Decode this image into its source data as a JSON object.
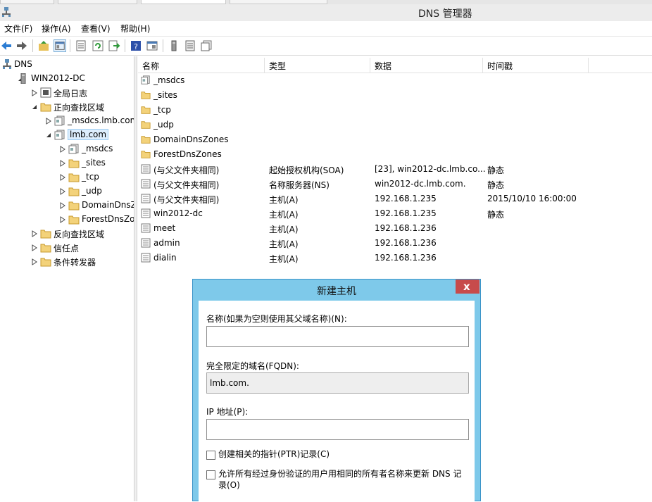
{
  "window": {
    "title": "DNS 管理器"
  },
  "menu": [
    "文件(F)",
    "操作(A)",
    "查看(V)",
    "帮助(H)"
  ],
  "toolbar": [
    "back-icon",
    "forward-icon",
    "up-folder-icon",
    "show-tree-icon",
    "properties-icon",
    "refresh-icon",
    "export-icon",
    "help-icon",
    "console-icon",
    "server-icon",
    "list-icon",
    "records-icon"
  ],
  "tree": [
    {
      "label": "DNS",
      "icon": "dns-root-icon",
      "arrow": "none"
    },
    {
      "label": "WIN2012-DC",
      "icon": "server-icon",
      "arrow": "expanded"
    },
    {
      "label": "全局日志",
      "icon": "log-icon",
      "arrow": "collapsed"
    },
    {
      "label": "正向查找区域",
      "icon": "folder-icon",
      "arrow": "expanded"
    },
    {
      "label": "_msdcs.lmb.com",
      "icon": "zone-icon",
      "arrow": "collapsed"
    },
    {
      "label": "lmb.com",
      "icon": "zone-icon",
      "arrow": "expanded",
      "selected": true
    },
    {
      "label": "_msdcs",
      "icon": "zone-icon",
      "arrow": "collapsed"
    },
    {
      "label": "_sites",
      "icon": "folder-icon",
      "arrow": "collapsed"
    },
    {
      "label": "_tcp",
      "icon": "folder-icon",
      "arrow": "collapsed"
    },
    {
      "label": "_udp",
      "icon": "folder-icon",
      "arrow": "collapsed"
    },
    {
      "label": "DomainDnsZones",
      "icon": "folder-icon",
      "arrow": "collapsed"
    },
    {
      "label": "ForestDnsZones",
      "icon": "folder-icon",
      "arrow": "collapsed"
    },
    {
      "label": "反向查找区域",
      "icon": "folder-icon",
      "arrow": "collapsed"
    },
    {
      "label": "信任点",
      "icon": "folder-icon",
      "arrow": "collapsed"
    },
    {
      "label": "条件转发器",
      "icon": "folder-icon",
      "arrow": "collapsed"
    }
  ],
  "list": {
    "columns": [
      "名称",
      "类型",
      "数据",
      "时间戳"
    ],
    "rows": [
      {
        "name": "_msdcs",
        "type": "",
        "data": "",
        "ts": "",
        "icon": "zone-icon"
      },
      {
        "name": "_sites",
        "type": "",
        "data": "",
        "ts": "",
        "icon": "folder-icon"
      },
      {
        "name": "_tcp",
        "type": "",
        "data": "",
        "ts": "",
        "icon": "folder-icon"
      },
      {
        "name": "_udp",
        "type": "",
        "data": "",
        "ts": "",
        "icon": "folder-icon"
      },
      {
        "name": "DomainDnsZones",
        "type": "",
        "data": "",
        "ts": "",
        "icon": "folder-icon"
      },
      {
        "name": "ForestDnsZones",
        "type": "",
        "data": "",
        "ts": "",
        "icon": "folder-icon"
      },
      {
        "name": "(与父文件夹相同)",
        "type": "起始授权机构(SOA)",
        "data": "[23], win2012-dc.lmb.co...",
        "ts": "静态",
        "icon": "record-icon"
      },
      {
        "name": "(与父文件夹相同)",
        "type": "名称服务器(NS)",
        "data": "win2012-dc.lmb.com.",
        "ts": "静态",
        "icon": "record-icon"
      },
      {
        "name": "(与父文件夹相同)",
        "type": "主机(A)",
        "data": "192.168.1.235",
        "ts": "2015/10/10 16:00:00",
        "icon": "record-icon"
      },
      {
        "name": "win2012-dc",
        "type": "主机(A)",
        "data": "192.168.1.235",
        "ts": "静态",
        "icon": "record-icon"
      },
      {
        "name": "meet",
        "type": "主机(A)",
        "data": "192.168.1.236",
        "ts": "",
        "icon": "record-icon"
      },
      {
        "name": "admin",
        "type": "主机(A)",
        "data": "192.168.1.236",
        "ts": "",
        "icon": "record-icon"
      },
      {
        "name": "dialin",
        "type": "主机(A)",
        "data": "192.168.1.236",
        "ts": "",
        "icon": "record-icon"
      }
    ]
  },
  "dialog": {
    "title": "新建主机",
    "close_glyph": "x",
    "name_label": "名称(如果为空则使用其父域名称)(N):",
    "name_value": "",
    "fqdn_label": "完全限定的域名(FQDN):",
    "fqdn_value": "lmb.com.",
    "ip_label": "IP 地址(P):",
    "ip_value": "",
    "ptr_label": "创建相关的指针(PTR)记录(C)",
    "allow_label": "允许所有经过身份验证的用户用相同的所有者名称来更新 DNS 记录(O)"
  },
  "colors": {
    "dialog_frame": "#7ec9ea",
    "close": "#c74b4b",
    "selection": "#ddeefd"
  }
}
